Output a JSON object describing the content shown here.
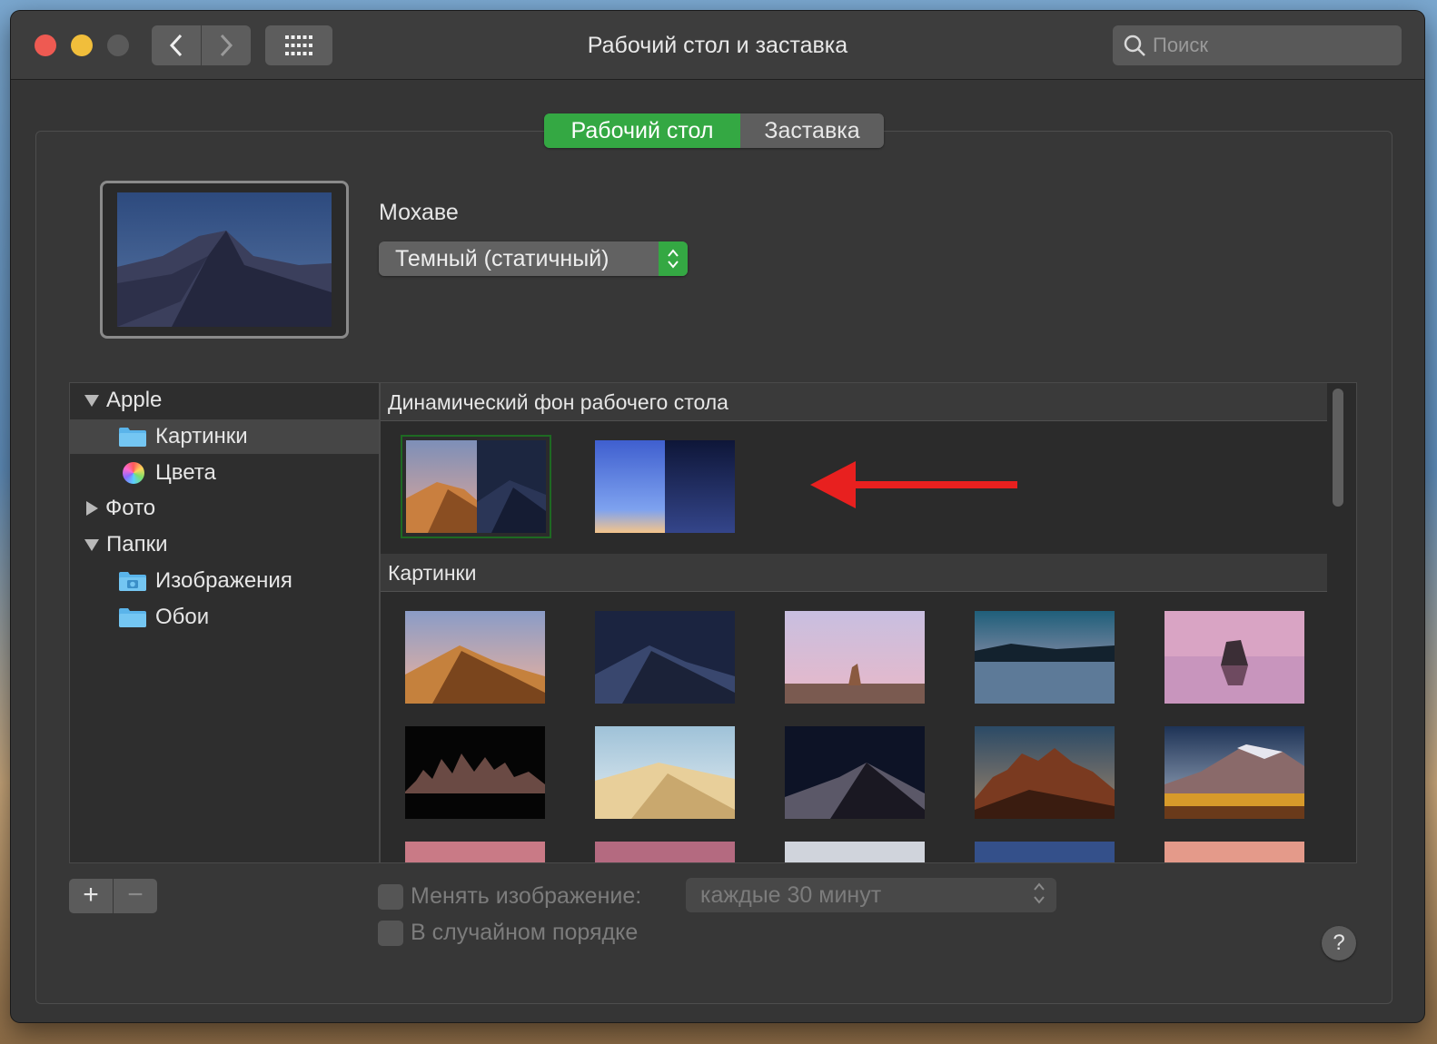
{
  "window": {
    "title": "Рабочий стол и заставка"
  },
  "search": {
    "placeholder": "Поиск"
  },
  "tabs": [
    {
      "label": "Рабочий стол",
      "active": true
    },
    {
      "label": "Заставка",
      "active": false
    }
  ],
  "wallpaper": {
    "name": "Мохаве",
    "mode": "Темный (статичный)"
  },
  "sidebar": {
    "items": [
      {
        "label": "Apple",
        "type": "group",
        "expanded": true
      },
      {
        "label": "Картинки",
        "type": "folder",
        "selected": true
      },
      {
        "label": "Цвета",
        "type": "colors"
      },
      {
        "label": "Фото",
        "type": "group",
        "expanded": false
      },
      {
        "label": "Папки",
        "type": "group",
        "expanded": true
      },
      {
        "label": "Изображения",
        "type": "camera-folder"
      },
      {
        "label": "Обои",
        "type": "folder"
      }
    ]
  },
  "sections": {
    "dynamic": {
      "title": "Динамический фон рабочего стола"
    },
    "pictures": {
      "title": "Картинки"
    }
  },
  "bottom": {
    "add_label": "+",
    "remove_label": "−",
    "change_picture_label": "Менять изображение:",
    "interval_value": "каждые 30 минут",
    "random_order_label": "В случайном порядке",
    "help_label": "?"
  },
  "colors": {
    "accent": "#34a843",
    "annotation_arrow": "#e8201f",
    "window_bg": "#353535"
  }
}
